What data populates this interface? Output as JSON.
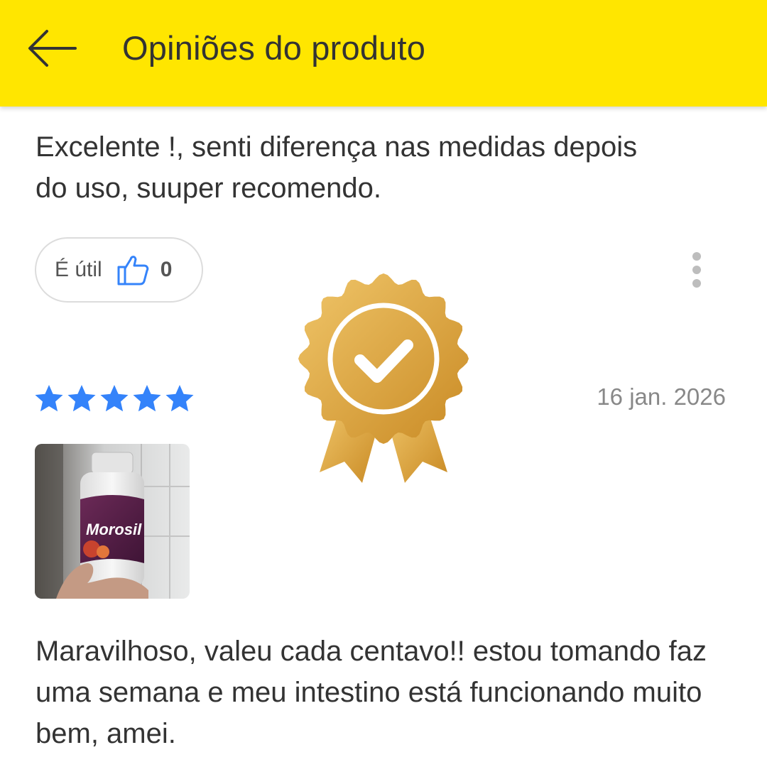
{
  "header": {
    "title": "Opiniões do produto",
    "background_color": "#ffe600",
    "back_icon": "arrow-left-icon"
  },
  "reviews": [
    {
      "text": "Excelente !, senti diferença nas medidas depois do uso, suuper recomendo.",
      "useful_label": "É útil",
      "useful_count": "0",
      "useful_icon": "thumbs-up-icon",
      "more_icon": "more-vertical-icon"
    },
    {
      "rating": 5,
      "rating_max": 5,
      "date": "16 jan. 2026",
      "photo": {
        "product_label": "Morosil"
      },
      "text": "Maravilhoso, valeu cada centavo!! estou tomando faz uma semana e meu intestino está funcionando muito bem, amei."
    }
  ],
  "overlay": {
    "badge_icon": "verified-badge-icon",
    "badge_color": "#d9a03a"
  },
  "colors": {
    "star": "#3483fa",
    "thumb": "#3483fa",
    "text": "#333333",
    "muted": "#888888"
  }
}
